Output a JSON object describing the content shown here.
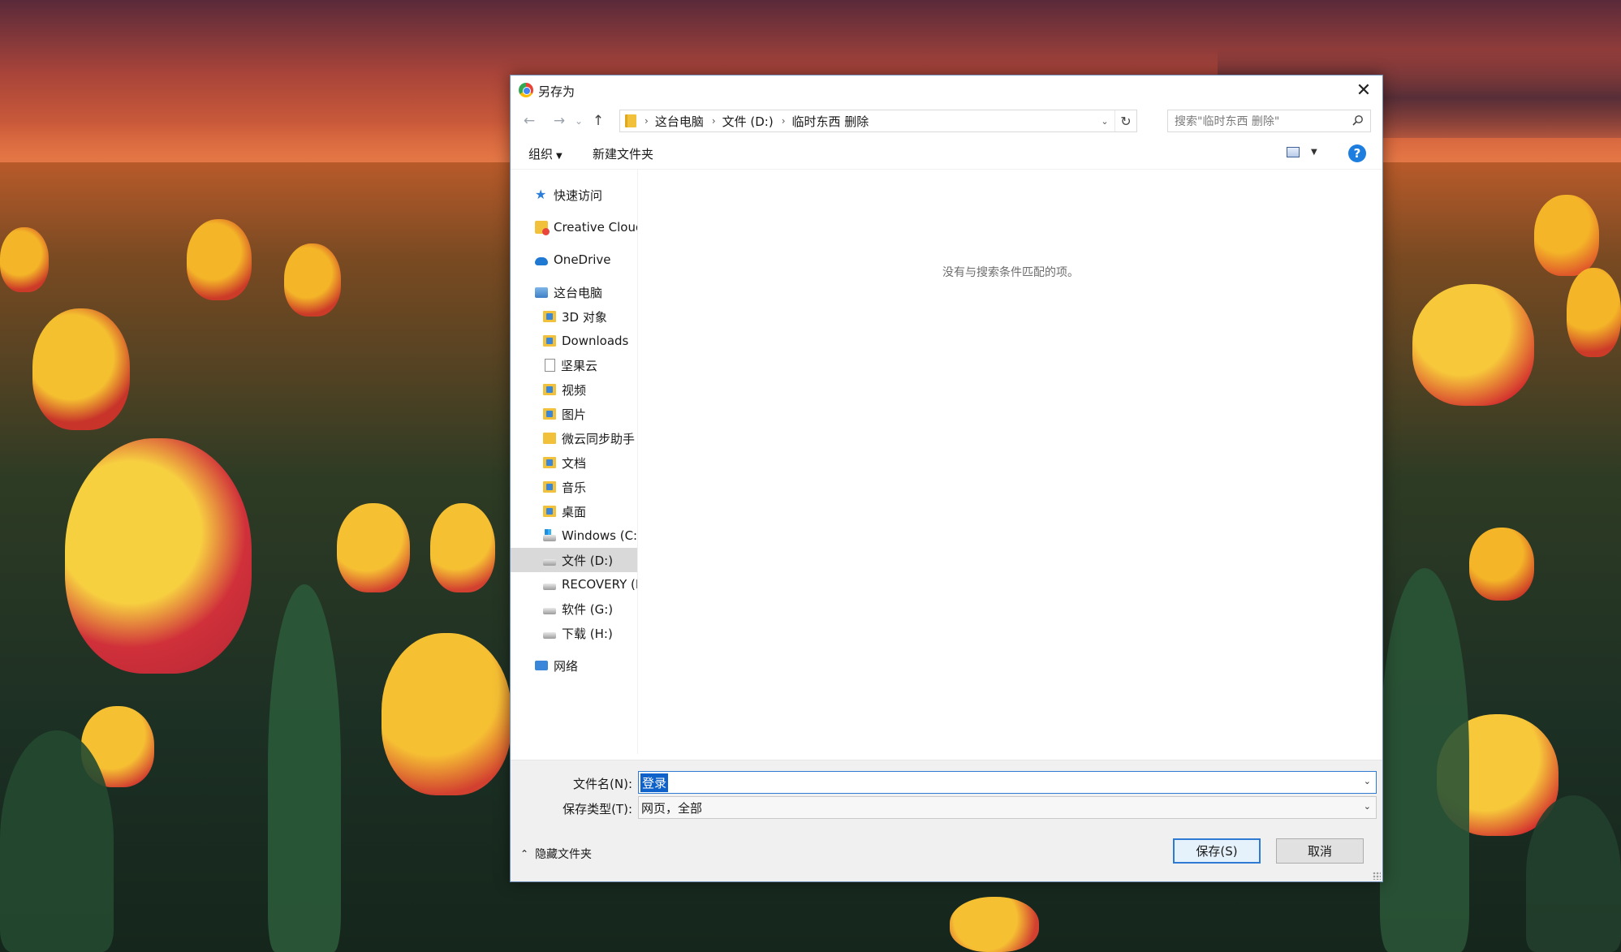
{
  "window": {
    "title": "另存为",
    "close_glyph": "✕"
  },
  "address": {
    "crumbs": [
      "这台电脑",
      "文件 (D:)",
      "临时东西 删除"
    ],
    "dropdown_glyph": "⌄",
    "refresh_glyph": "↻"
  },
  "nav_buttons": {
    "back": "←",
    "forward": "→",
    "recent": "⌄",
    "up": "↑"
  },
  "search": {
    "placeholder": "搜索\"临时东西 删除\""
  },
  "toolbar": {
    "organize": "组织",
    "new_folder": "新建文件夹",
    "help": "?"
  },
  "nav_pane": {
    "items": [
      {
        "label": "快速访问",
        "icon": "star-icon"
      },
      {
        "label": "Creative Cloud Files",
        "icon": "creative-cloud-folder-icon"
      },
      {
        "label": "OneDrive",
        "icon": "cloud-icon"
      },
      {
        "label": "这台电脑",
        "icon": "computer-icon"
      },
      {
        "label": "3D 对象",
        "icon": "folder-3d-icon"
      },
      {
        "label": "Downloads",
        "icon": "folder-download-icon"
      },
      {
        "label": "坚果云",
        "icon": "document-icon"
      },
      {
        "label": "视频",
        "icon": "folder-video-icon"
      },
      {
        "label": "图片",
        "icon": "folder-pictures-icon"
      },
      {
        "label": "微云同步助手",
        "icon": "folder-cloud-icon"
      },
      {
        "label": "文档",
        "icon": "folder-documents-icon"
      },
      {
        "label": "音乐",
        "icon": "folder-music-icon"
      },
      {
        "label": "桌面",
        "icon": "folder-desktop-icon"
      },
      {
        "label": "Windows (C:)",
        "icon": "windows-drive-icon"
      },
      {
        "label": "文件 (D:)",
        "icon": "drive-icon"
      },
      {
        "label": "RECOVERY (E:)",
        "icon": "drive-icon"
      },
      {
        "label": "软件  (G:)",
        "icon": "drive-icon"
      },
      {
        "label": "下载 (H:)",
        "icon": "drive-icon"
      },
      {
        "label": "网络",
        "icon": "network-icon"
      }
    ]
  },
  "content": {
    "empty_message": "没有与搜索条件匹配的项。"
  },
  "form": {
    "filename_label": "文件名(N):",
    "filename_value": "登录",
    "filetype_label": "保存类型(T):",
    "filetype_value": "网页，全部",
    "hide_folders": "隐藏文件夹",
    "save": "保存(S)",
    "cancel": "取消",
    "combo_glyph": "⌄"
  },
  "colors": {
    "accent": "#2f7bd4",
    "selection": "#0f62c9",
    "help": "#1e7ee0"
  }
}
